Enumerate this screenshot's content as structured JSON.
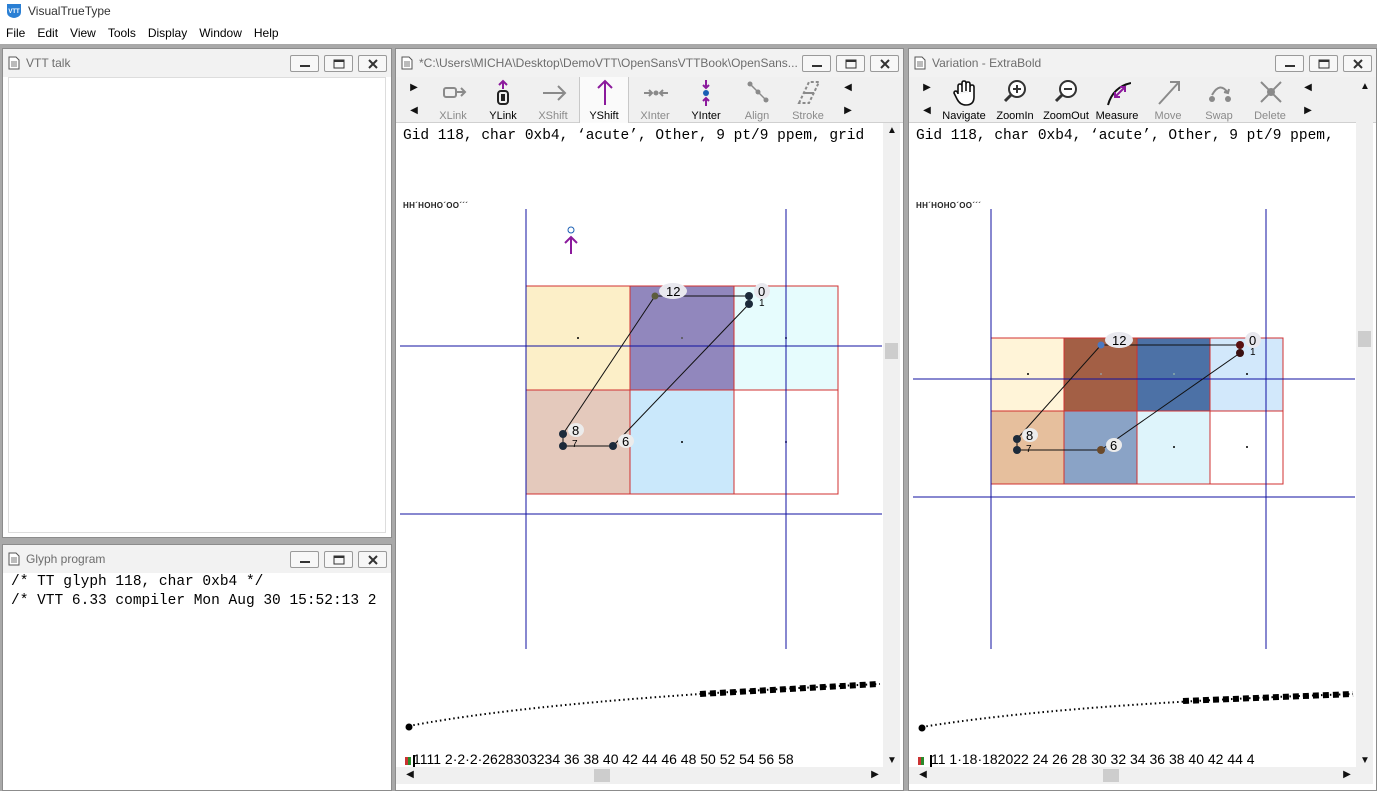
{
  "app": {
    "title": "VisualTrueType",
    "logo_text": "VTT"
  },
  "menu": [
    "File",
    "Edit",
    "View",
    "Tools",
    "Display",
    "Window",
    "Help"
  ],
  "colors": {
    "guide_blue": "#1010a0",
    "grid_red": "#d03030",
    "ruler_purple": "#8a1a8a",
    "tool_purple": "#8b1a9c",
    "tool_gray": "#8a8a8a"
  },
  "talk_window": {
    "title": "VTT talk"
  },
  "glyph_program_window": {
    "title": "Glyph program",
    "lines": [
      "/* TT glyph 118, char 0xb4 */",
      "/* VTT 6.33 compiler Mon Aug 30 15:52:13 2"
    ]
  },
  "main_window": {
    "title": "*C:\\Users\\MICHA\\Desktop\\DemoVTT\\OpenSansVTTBook\\OpenSans...",
    "tools": [
      {
        "label": "XLink",
        "icon": "xlink-icon"
      },
      {
        "label": "YLink",
        "icon": "ylink-icon"
      },
      {
        "label": "XShift",
        "icon": "xshift-icon"
      },
      {
        "label": "YShift",
        "icon": "yshift-icon"
      },
      {
        "label": "XInter",
        "icon": "xinter-icon"
      },
      {
        "label": "YInter",
        "icon": "yinter-icon"
      },
      {
        "label": "Align",
        "icon": "align-icon"
      },
      {
        "label": "Stroke",
        "icon": "stroke-icon"
      }
    ],
    "info": "Gid 118, char 0xb4, ‘acute’, Other, 9 pt/9 ppem, grid",
    "sample_text": "HH´HOHO´OO´´´",
    "point_labels": [
      "12",
      "0",
      "1",
      "8",
      "7",
      "6"
    ],
    "ruler": "111112•2•2•262830323436 38 40 42 44 46 48 50 52 54 56 58",
    "ruler_display": "1111 2·2·2·2628303234 36 38 40 42 44 46 48 50 52 54 56 58"
  },
  "variation_window": {
    "title": "Variation - ExtraBold",
    "tools": [
      {
        "label": "Navigate",
        "icon": "hand-icon"
      },
      {
        "label": "ZoomIn",
        "icon": "zoom-in-icon"
      },
      {
        "label": "ZoomOut",
        "icon": "zoom-out-icon"
      },
      {
        "label": "Measure",
        "icon": "measure-icon"
      },
      {
        "label": "Move",
        "icon": "move-icon"
      },
      {
        "label": "Swap",
        "icon": "swap-icon"
      },
      {
        "label": "Delete",
        "icon": "delete-icon"
      }
    ],
    "info": "Gid 118, char 0xb4, ‘acute’, Other, 9 pt/9 ppem,",
    "sample_text": "HH´HOHO´OO´´´",
    "point_labels": [
      "12",
      "0",
      "1",
      "8",
      "7",
      "6"
    ],
    "ruler_display": "11 1·18·182022 24 26 28 30 32 34 36 38 40 42 44 4"
  }
}
